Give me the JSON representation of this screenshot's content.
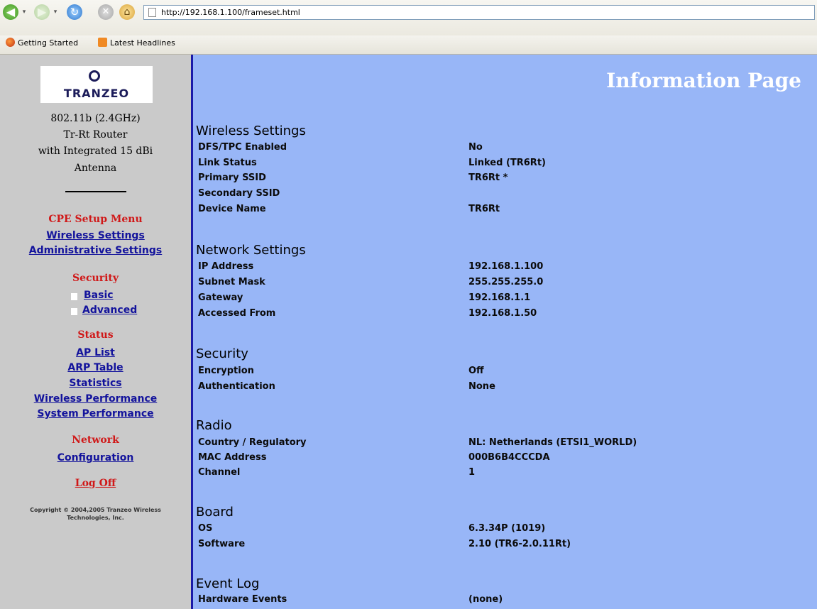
{
  "browser": {
    "url": "http://192.168.1.100/frameset.html",
    "bookmarks": [
      "Getting Started",
      "Latest Headlines"
    ]
  },
  "sidebar": {
    "logo_text": "TRANZEO",
    "device_lines": [
      "802.11b (2.4GHz)",
      "Tr-Rt Router",
      "with Integrated 15 dBi",
      "Antenna"
    ],
    "cpe_setup_heading": "CPE Setup Menu",
    "cpe_links": [
      "Wireless Settings",
      "Administrative Settings"
    ],
    "security_heading": "Security",
    "security_links": [
      "Basic",
      "Advanced"
    ],
    "status_heading": "Status",
    "status_links": [
      "AP List",
      "ARP Table",
      "Statistics",
      "Wireless Performance",
      "System Performance"
    ],
    "network_heading": "Network",
    "network_links": [
      "Configuration"
    ],
    "logoff": "Log Off",
    "copyright_lines": [
      "Copyright © 2004,2005 Tranzeo Wireless",
      "Technologies, Inc."
    ]
  },
  "main": {
    "title": "Information Page",
    "sections": [
      {
        "heading": "Wireless Settings",
        "rows": [
          {
            "label": "DFS/TPC Enabled",
            "value": "No"
          },
          {
            "label": "Link Status",
            "value": "Linked (TR6Rt)"
          },
          {
            "label": "Primary SSID",
            "value": "TR6Rt *"
          },
          {
            "label": "Secondary SSID",
            "value": ""
          },
          {
            "label": "Device Name",
            "value": "TR6Rt"
          }
        ]
      },
      {
        "heading": "Network Settings",
        "rows": [
          {
            "label": "IP Address",
            "value": "192.168.1.100"
          },
          {
            "label": "Subnet Mask",
            "value": "255.255.255.0"
          },
          {
            "label": "Gateway",
            "value": "192.168.1.1"
          },
          {
            "label": "Accessed From",
            "value": "192.168.1.50"
          }
        ]
      },
      {
        "heading": "Security",
        "rows": [
          {
            "label": "Encryption",
            "value": "Off"
          },
          {
            "label": "Authentication",
            "value": "None"
          }
        ]
      },
      {
        "heading": "Radio",
        "rows": [
          {
            "label": "Country / Regulatory",
            "value": "NL: Netherlands (ETSI1_WORLD)"
          },
          {
            "label": "MAC Address",
            "value": "000B6B4CCCDA"
          },
          {
            "label": "Channel",
            "value": "1"
          }
        ]
      },
      {
        "heading": "Board",
        "rows": [
          {
            "label": "OS",
            "value": "6.3.34P (1019)"
          },
          {
            "label": "Software",
            "value": "2.10 (TR6-2.0.11Rt)"
          }
        ]
      },
      {
        "heading": "Event Log",
        "rows": [
          {
            "label": "Hardware Events",
            "value": "(none)"
          }
        ]
      }
    ]
  }
}
